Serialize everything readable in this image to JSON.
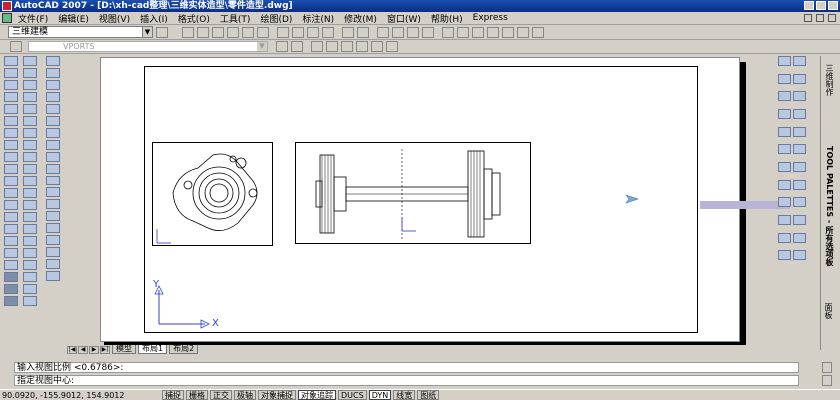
{
  "window": {
    "title": "AutoCAD 2007 - [D:\\xh-cad整理\\三维实体造型\\零件造型.dwg]"
  },
  "menu": {
    "items": [
      "文件(F)",
      "编辑(E)",
      "视图(V)",
      "插入(I)",
      "格式(O)",
      "工具(T)",
      "绘图(D)",
      "标注(N)",
      "修改(M)",
      "窗口(W)",
      "帮助(H)",
      "Express"
    ]
  },
  "toolbar": {
    "workspace_value": "三维建模",
    "layer_value": "VPORTS"
  },
  "drawing": {
    "ucs_y_label": "Y",
    "ucs_x_label": "X"
  },
  "layout_tabs": {
    "items": [
      "模型",
      "布局1",
      "布局2"
    ]
  },
  "command": {
    "line1": "输入视图比例 <0.6786>:",
    "line2": "指定视图中心:"
  },
  "tool_palettes": {
    "label": "TOOL PALETTES - 所有选项板",
    "top_label": "三维制作",
    "bottom_label": "面板"
  },
  "status": {
    "coordinates": "90.0920, -155.9012, 154.9012",
    "buttons": [
      {
        "label": "捕捉",
        "on": false
      },
      {
        "label": "栅格",
        "on": false
      },
      {
        "label": "正交",
        "on": false
      },
      {
        "label": "极轴",
        "on": false
      },
      {
        "label": "对象捕捉",
        "on": false
      },
      {
        "label": "对象追踪",
        "on": true
      },
      {
        "label": "DUCS",
        "on": false
      },
      {
        "label": "DYN",
        "on": true
      },
      {
        "label": "线宽",
        "on": false
      },
      {
        "label": "图纸",
        "on": false
      }
    ]
  }
}
